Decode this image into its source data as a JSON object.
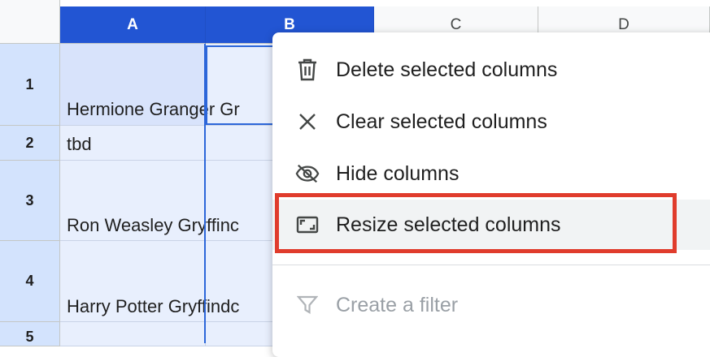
{
  "columns": [
    "A",
    "B",
    "C",
    "D"
  ],
  "rows": [
    {
      "num": "1",
      "cell_a": "Hermione Granger Gr"
    },
    {
      "num": "2",
      "cell_a": "tbd"
    },
    {
      "num": "3",
      "cell_a": "Ron Weasley Gryffinc"
    },
    {
      "num": "4",
      "cell_a": "Harry Potter Gryffindc"
    },
    {
      "num": "5",
      "cell_a": ""
    }
  ],
  "context_menu": {
    "delete": "Delete selected columns",
    "clear": "Clear selected columns",
    "hide": "Hide columns",
    "resize": "Resize selected columns",
    "filter": "Create a filter"
  },
  "colors": {
    "selected_header": "#2255d3",
    "selection_fill": "#e8effd",
    "highlight": "#e03c2c"
  }
}
